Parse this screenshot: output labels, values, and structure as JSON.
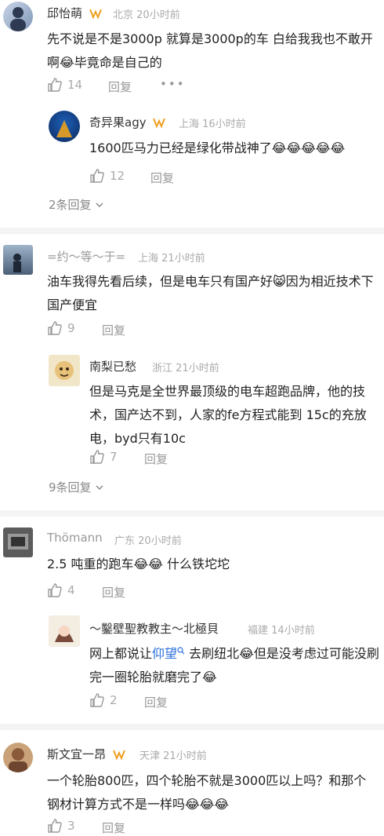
{
  "comments": [
    {
      "name": "邱怡萌",
      "location": "北京",
      "time": "20小时前",
      "text": "先不说是不是3000p 就算是3000p的车 白给我我也不敢开啊😂毕竟命是自己的",
      "likes": "14",
      "reply_label": "回复",
      "more": "•••",
      "replies": [
        {
          "name": "奇异果agy",
          "location": "上海",
          "time": "16小时前",
          "text": "1600匹马力已经是绿化带战神了😂😂😂😂😂",
          "likes": "12",
          "reply_label": "回复"
        }
      ],
      "more_replies": "2条回复"
    },
    {
      "name": "=约～等～于=",
      "location": "上海",
      "time": "21小时前",
      "text": "油车我得先看后续，但是电车只有国产好😸因为相近技术下国产便宜",
      "likes": "9",
      "reply_label": "回复",
      "replies": [
        {
          "name": "南梨已愁",
          "location": "浙江",
          "time": "21小时前",
          "text": "但是马克是全世界最顶级的电车超跑品牌，他的技术，国产达不到，人家的fe方程式能到 15c的充放电，byd只有10c",
          "likes": "7",
          "reply_label": "回复"
        }
      ],
      "more_replies": "9条回复"
    },
    {
      "name": "Thömann",
      "location": "广东",
      "time": "20小时前",
      "text": "2.5 吨重的跑车😂😂 什么铁坨坨",
      "likes": "4",
      "reply_label": "回复",
      "replies": [
        {
          "name": "～鑿壁聖教教主～北極貝",
          "location": "福建",
          "time": "14小时前",
          "text_before": "网上都说让",
          "link": "仰望",
          "text_after": " 去刷纽北😂但是没考虑过可能没刷完一圈轮胎就磨完了😂",
          "likes": "2",
          "reply_label": "回复"
        }
      ]
    },
    {
      "name": "斯文宜一昂",
      "location": "天津",
      "time": "21小时前",
      "text": "一个轮胎800匹，四个轮胎不就是3000匹以上吗？和那个钢材计算方式不是一样吗😂😂😂",
      "likes": "3",
      "reply_label": "回复"
    }
  ],
  "colors": {
    "vip": "#f0a020",
    "link": "#2a6fdb",
    "emoji": "#f7c948"
  }
}
